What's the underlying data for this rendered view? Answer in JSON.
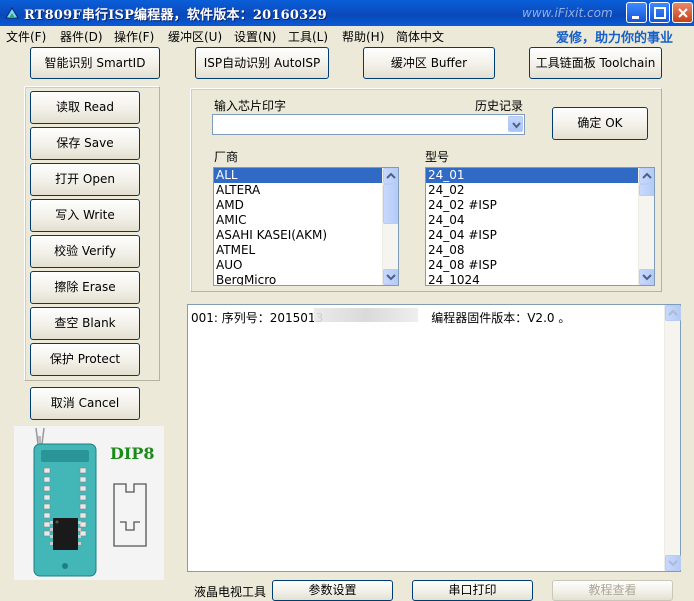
{
  "window": {
    "title": "RT809F串行ISP编程器，软件版本：20160329",
    "watermark": "www.iFixit.com",
    "slogan": "爱修，助力你的事业"
  },
  "menu": [
    "文件(F)",
    "器件(D)",
    "操作(F)",
    "缓冲区(U)",
    "设置(N)",
    "工具(L)",
    "帮助(H)",
    "简体中文"
  ],
  "top_buttons": {
    "smart_id": "智能识别 SmartID",
    "isp_auto": "ISP自动识别 AutoISP",
    "buffer": "缓冲区 Buffer",
    "toolchain": "工具链面板 Toolchain"
  },
  "side_buttons": {
    "read": "读取 Read",
    "save": "保存 Save",
    "open": "打开 Open",
    "write": "写入 Write",
    "verify": "校验 Verify",
    "erase": "擦除 Erase",
    "blank": "查空 Blank",
    "protect": "保护 Protect",
    "cancel": "取消 Cancel"
  },
  "chip_input": {
    "label": "输入芯片印字",
    "history_label": "历史记录",
    "value": "",
    "ok_button": "确定 OK"
  },
  "vendor": {
    "label": "厂商",
    "items": [
      "ALL",
      "ALTERA",
      "AMD",
      "AMIC",
      "ASAHI KASEI(AKM)",
      "ATMEL",
      "AUO",
      "BergMicro"
    ],
    "selected": "ALL"
  },
  "model": {
    "label": "型号",
    "items": [
      "24_01",
      "24_02",
      "24_02 #ISP",
      "24_04",
      "24_04 #ISP",
      "24_08",
      "24_08 #ISP",
      "24_1024"
    ],
    "selected": "24_01"
  },
  "log": {
    "line_prefix": "001: 序列号：2015013",
    "line_suffix": "编程器固件版本：V2.0 。"
  },
  "chip": {
    "package_label": "DIP8"
  },
  "bottom": {
    "lcd_tool": "液晶电视工具",
    "params_button": "参数设置",
    "serial_button": "串口打印",
    "tutorial_button": "教程查看"
  },
  "colors": {
    "titlebar": "#0b4fc4",
    "selection": "#316ac5",
    "slogan": "#1761c8",
    "dip_label": "#1a8a1a"
  }
}
